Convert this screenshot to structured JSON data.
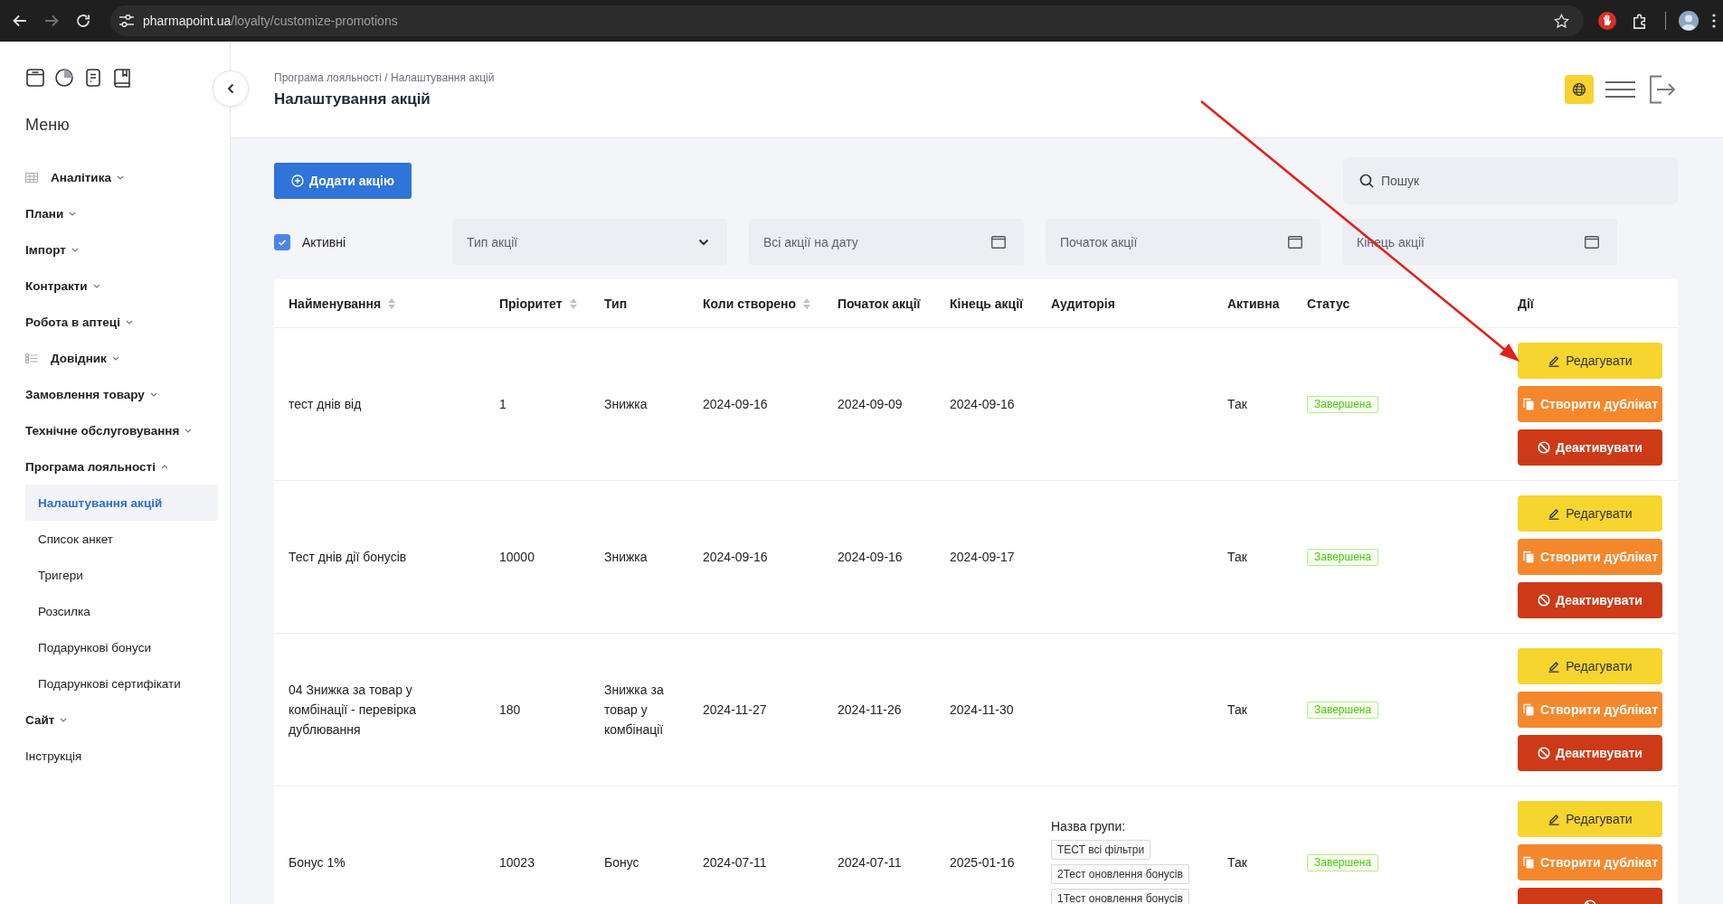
{
  "browser": {
    "nav": [
      {
        "kind": "back",
        "disabled": false
      },
      {
        "kind": "forward",
        "disabled": true
      },
      {
        "kind": "reload",
        "disabled": false
      }
    ],
    "url_host": "pharmapoint.ua",
    "url_path": "/loyalty/customize-promotions"
  },
  "sidebar": {
    "title": "Меню",
    "items": [
      {
        "label": "Аналітика",
        "kind": "group",
        "expanded": false
      },
      {
        "label": "Плани",
        "kind": "group",
        "expanded": false
      },
      {
        "label": "Імпорт",
        "kind": "group",
        "expanded": false
      },
      {
        "label": "Контракти",
        "kind": "group",
        "expanded": false
      },
      {
        "label": "Робота в аптеці",
        "kind": "group",
        "expanded": false
      },
      {
        "label": "Довідник",
        "kind": "group",
        "expanded": false
      },
      {
        "label": "Замовлення товару",
        "kind": "group",
        "expanded": false
      },
      {
        "label": "Технічне обслуговування",
        "kind": "group",
        "expanded": false
      },
      {
        "label": "Програма лояльності",
        "kind": "group",
        "expanded": true,
        "children": [
          {
            "label": "Налаштування акцій",
            "selected": true
          },
          {
            "label": "Список анкет",
            "selected": false
          },
          {
            "label": "Тригери",
            "selected": false
          },
          {
            "label": "Розсилка",
            "selected": false
          },
          {
            "label": "Подарункові бонуси",
            "selected": false
          },
          {
            "label": "Подарункові сертифікати",
            "selected": false
          }
        ]
      },
      {
        "label": "Сайт",
        "kind": "group",
        "expanded": false
      },
      {
        "label": "Інструкція",
        "kind": "link"
      }
    ]
  },
  "header": {
    "breadcrumb": "Програма лояльності / Налаштування акцій",
    "title": "Налаштування акцій"
  },
  "toolbar": {
    "add_button": "Додати акцію",
    "search": {
      "placeholder": "Пошук"
    }
  },
  "filters": {
    "active": {
      "label": "Активні",
      "checked": true
    },
    "fields": [
      {
        "kind": "select",
        "placeholder": "Тип акції"
      },
      {
        "kind": "date",
        "placeholder": "Всі акції на дату"
      },
      {
        "kind": "date",
        "placeholder": "Початок акції"
      },
      {
        "kind": "date",
        "placeholder": "Кінець акції"
      }
    ]
  },
  "table": {
    "columns": [
      {
        "label": "Найменування",
        "sortable": true
      },
      {
        "label": "Пріоритет",
        "sortable": true
      },
      {
        "label": "Тип",
        "sortable": false
      },
      {
        "label": "Коли створено",
        "sortable": true
      },
      {
        "label": "Початок акції",
        "sortable": false
      },
      {
        "label": "Кінець акції",
        "sortable": false
      },
      {
        "label": "Аудиторія",
        "sortable": false
      },
      {
        "label": "Активна",
        "sortable": false
      },
      {
        "label": "Статус",
        "sortable": false
      },
      {
        "label": "Дії",
        "sortable": false
      }
    ],
    "rows": [
      {
        "name": "тест днів від",
        "priority": "1",
        "type": "Знижка",
        "created": "2024-09-16",
        "start": "2024-09-09",
        "end": "2024-09-16",
        "active": "Так",
        "status": {
          "label": "Завершена",
          "kind": "finished"
        },
        "actions": [
          {
            "kind": "edit",
            "label": "Редагувати"
          },
          {
            "kind": "duplicate",
            "label": "Створити дублікат"
          },
          {
            "kind": "deactivate",
            "label": "Деактивувати"
          }
        ]
      },
      {
        "name": "Тест днів дії бонусів",
        "priority": "10000",
        "type": "Знижка",
        "created": "2024-09-16",
        "start": "2024-09-16",
        "end": "2024-09-17",
        "active": "Так",
        "status": {
          "label": "Завершена",
          "kind": "finished"
        },
        "actions": [
          {
            "kind": "edit",
            "label": "Редагувати"
          },
          {
            "kind": "duplicate",
            "label": "Створити дублікат"
          },
          {
            "kind": "deactivate",
            "label": "Деактивувати"
          }
        ]
      },
      {
        "name": "04 Знижка за товар у комбінації - перевірка дублювання",
        "priority": "180",
        "type": "Знижка за товар у комбінації",
        "created": "2024-11-27",
        "start": "2024-11-26",
        "end": "2024-11-30",
        "active": "Так",
        "status": {
          "label": "Завершена",
          "kind": "finished"
        },
        "actions": [
          {
            "kind": "edit",
            "label": "Редагувати"
          },
          {
            "kind": "duplicate",
            "label": "Створити дублікат"
          },
          {
            "kind": "deactivate",
            "label": "Деактивувати"
          }
        ]
      },
      {
        "name": "Бонус 1%",
        "priority": "10023",
        "type": "Бонус",
        "created": "2024-07-11",
        "start": "2024-07-11",
        "end": "2025-01-16",
        "audience": {
          "label": "Назва групи:",
          "tags": [
            "ТЕСТ всі фільтри",
            "2Тест оновлення бонусів",
            "1Тест оновлення бонусів"
          ]
        },
        "active": "Так",
        "status": {
          "label": "Завершена",
          "kind": "finished"
        },
        "actions": [
          {
            "kind": "edit",
            "label": "Редагувати"
          },
          {
            "kind": "duplicate",
            "label": "Створити дублікат"
          },
          {
            "kind": "deactivate"
          }
        ]
      }
    ]
  },
  "annotation": {
    "kind": "arrow"
  }
}
